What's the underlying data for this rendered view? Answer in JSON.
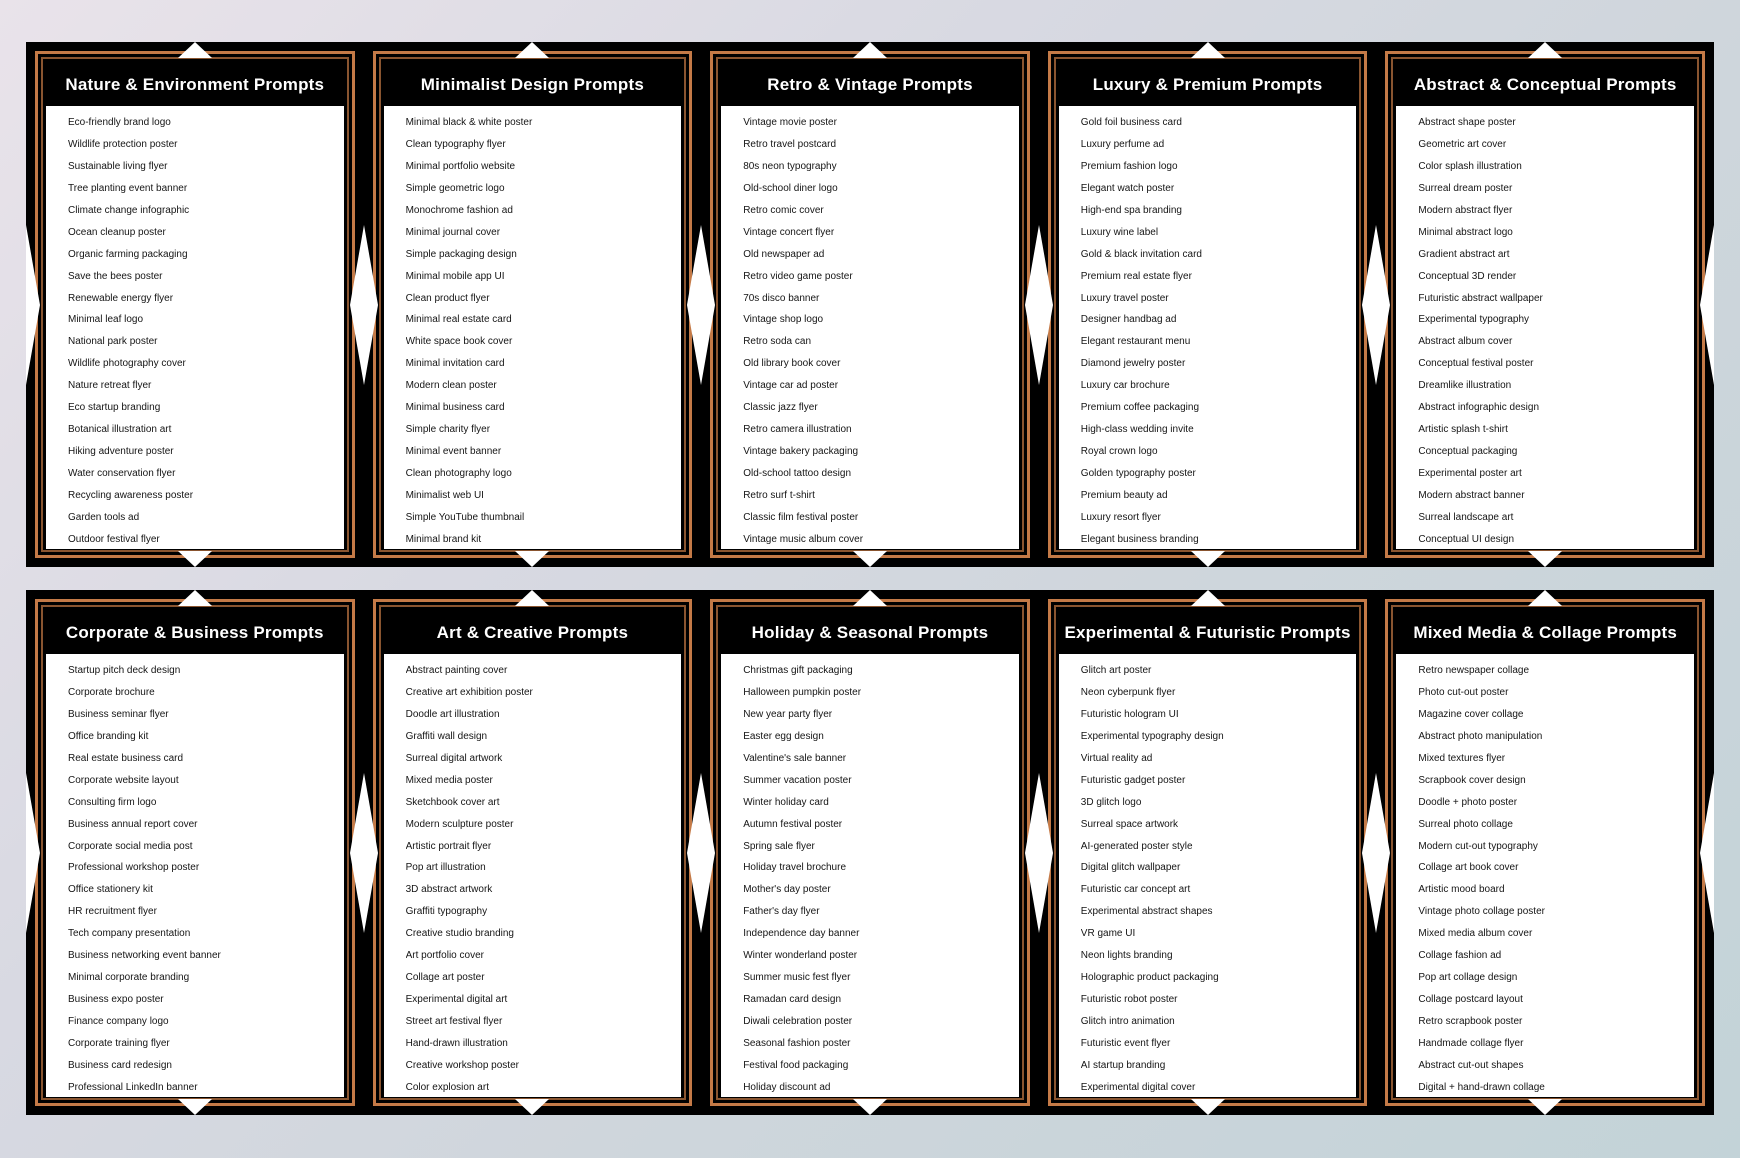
{
  "rows": [
    [
      {
        "title": "Nature & Environment Prompts",
        "items": [
          "Eco-friendly brand logo",
          "Wildlife protection poster",
          "Sustainable living flyer",
          "Tree planting event banner",
          "Climate change infographic",
          "Ocean cleanup poster",
          "Organic farming packaging",
          "Save the bees poster",
          "Renewable energy flyer",
          "Minimal leaf logo",
          "National park poster",
          "Wildlife photography cover",
          "Nature retreat flyer",
          "Eco startup branding",
          "Botanical illustration art",
          "Hiking adventure poster",
          "Water conservation flyer",
          "Recycling awareness poster",
          "Garden tools ad",
          "Outdoor festival flyer"
        ]
      },
      {
        "title": "Minimalist Design Prompts",
        "items": [
          "Minimal black & white poster",
          "Clean typography flyer",
          "Minimal portfolio website",
          "Simple geometric logo",
          "Monochrome fashion ad",
          "Minimal journal cover",
          "Simple packaging design",
          "Minimal mobile app UI",
          "Clean product flyer",
          "Minimal real estate card",
          "White space book cover",
          "Minimal invitation card",
          "Modern clean poster",
          "Minimal business card",
          "Simple charity flyer",
          "Minimal event banner",
          "Clean photography logo",
          "Minimalist web UI",
          "Simple YouTube thumbnail",
          "Minimal brand kit"
        ]
      },
      {
        "title": "Retro & Vintage Prompts",
        "items": [
          "Vintage movie poster",
          "Retro travel postcard",
          "80s neon typography",
          "Old-school diner logo",
          "Retro comic cover",
          "Vintage concert flyer",
          "Old newspaper ad",
          "Retro video game poster",
          "70s disco banner",
          "Vintage shop logo",
          "Retro soda can",
          "Old library book cover",
          "Vintage car ad poster",
          "Classic jazz flyer",
          "Retro camera illustration",
          "Vintage bakery packaging",
          "Old-school tattoo design",
          "Retro surf t-shirt",
          "Classic film festival poster",
          "Vintage music album cover"
        ]
      },
      {
        "title": "Luxury & Premium Prompts",
        "items": [
          "Gold foil business card",
          "Luxury perfume ad",
          "Premium fashion logo",
          "Elegant watch poster",
          "High-end spa branding",
          "Luxury wine label",
          "Gold & black invitation card",
          "Premium real estate flyer",
          "Luxury travel poster",
          "Designer handbag ad",
          "Elegant restaurant menu",
          "Diamond jewelry poster",
          "Luxury car brochure",
          "Premium coffee packaging",
          "High-class wedding invite",
          "Royal crown logo",
          "Golden typography poster",
          "Premium beauty ad",
          "Luxury resort flyer",
          "Elegant business branding"
        ]
      },
      {
        "title": "Abstract & Conceptual Prompts",
        "items": [
          "Abstract shape poster",
          "Geometric art cover",
          "Color splash illustration",
          "Surreal dream poster",
          "Modern abstract flyer",
          "Minimal abstract logo",
          "Gradient abstract art",
          "Conceptual 3D render",
          "Futuristic abstract wallpaper",
          "Experimental typography",
          "Abstract album cover",
          "Conceptual festival poster",
          "Dreamlike illustration",
          "Abstract infographic design",
          "Artistic splash t-shirt",
          "Conceptual packaging",
          "Experimental poster art",
          "Modern abstract banner",
          "Surreal landscape art",
          "Conceptual UI design"
        ]
      }
    ],
    [
      {
        "title": "Corporate & Business Prompts",
        "items": [
          "Startup pitch deck design",
          "Corporate brochure",
          "Business seminar flyer",
          "Office branding kit",
          "Real estate business card",
          "Corporate website layout",
          "Consulting firm logo",
          "Business annual report cover",
          "Corporate social media post",
          "Professional workshop poster",
          "Office stationery kit",
          "HR recruitment flyer",
          "Tech company presentation",
          "Business networking event banner",
          "Minimal corporate branding",
          "Business expo poster",
          "Finance company logo",
          "Corporate training flyer",
          "Business card redesign",
          "Professional LinkedIn banner"
        ]
      },
      {
        "title": "Art & Creative Prompts",
        "items": [
          "Abstract painting cover",
          "Creative art exhibition poster",
          "Doodle art illustration",
          "Graffiti wall design",
          "Surreal digital artwork",
          "Mixed media poster",
          "Sketchbook cover art",
          "Modern sculpture poster",
          "Artistic portrait flyer",
          "Pop art illustration",
          "3D abstract artwork",
          "Graffiti typography",
          "Creative studio branding",
          "Art portfolio cover",
          "Collage art poster",
          "Experimental digital art",
          "Street art festival flyer",
          "Hand-drawn illustration",
          "Creative workshop poster",
          "Color explosion art"
        ]
      },
      {
        "title": "Holiday & Seasonal Prompts",
        "items": [
          "Christmas gift packaging",
          "Halloween pumpkin poster",
          "New year party flyer",
          "Easter egg design",
          "Valentine's sale banner",
          "Summer vacation poster",
          "Winter holiday card",
          "Autumn festival poster",
          "Spring sale flyer",
          "Holiday travel brochure",
          "Mother's day poster",
          "Father's day flyer",
          "Independence day banner",
          "Winter wonderland poster",
          "Summer music fest flyer",
          "Ramadan card design",
          "Diwali celebration poster",
          "Seasonal fashion poster",
          "Festival food packaging",
          "Holiday discount ad"
        ]
      },
      {
        "title": "Experimental & Futuristic Prompts",
        "items": [
          "Glitch art poster",
          "Neon cyberpunk flyer",
          "Futuristic hologram UI",
          "Experimental typography design",
          "Virtual reality ad",
          "Futuristic gadget poster",
          "3D glitch logo",
          "Surreal space artwork",
          "AI-generated poster style",
          "Digital glitch wallpaper",
          "Futuristic car concept art",
          "Experimental abstract shapes",
          "VR game UI",
          "Neon lights branding",
          "Holographic product packaging",
          "Futuristic robot poster",
          "Glitch intro animation",
          "Futuristic event flyer",
          "AI startup branding",
          "Experimental digital cover"
        ]
      },
      {
        "title": "Mixed Media & Collage Prompts",
        "items": [
          "Retro newspaper collage",
          "Photo cut-out poster",
          "Magazine cover collage",
          "Abstract photo manipulation",
          "Mixed textures flyer",
          "Scrapbook cover design",
          "Doodle + photo poster",
          "Surreal photo collage",
          "Modern cut-out typography",
          "Collage art book cover",
          "Artistic mood board",
          "Vintage photo collage poster",
          "Mixed media album cover",
          "Collage fashion ad",
          "Pop art collage design",
          "Collage postcard layout",
          "Retro scrapbook poster",
          "Handmade collage flyer",
          "Abstract cut-out shapes",
          "Digital + hand-drawn collage"
        ]
      }
    ]
  ]
}
